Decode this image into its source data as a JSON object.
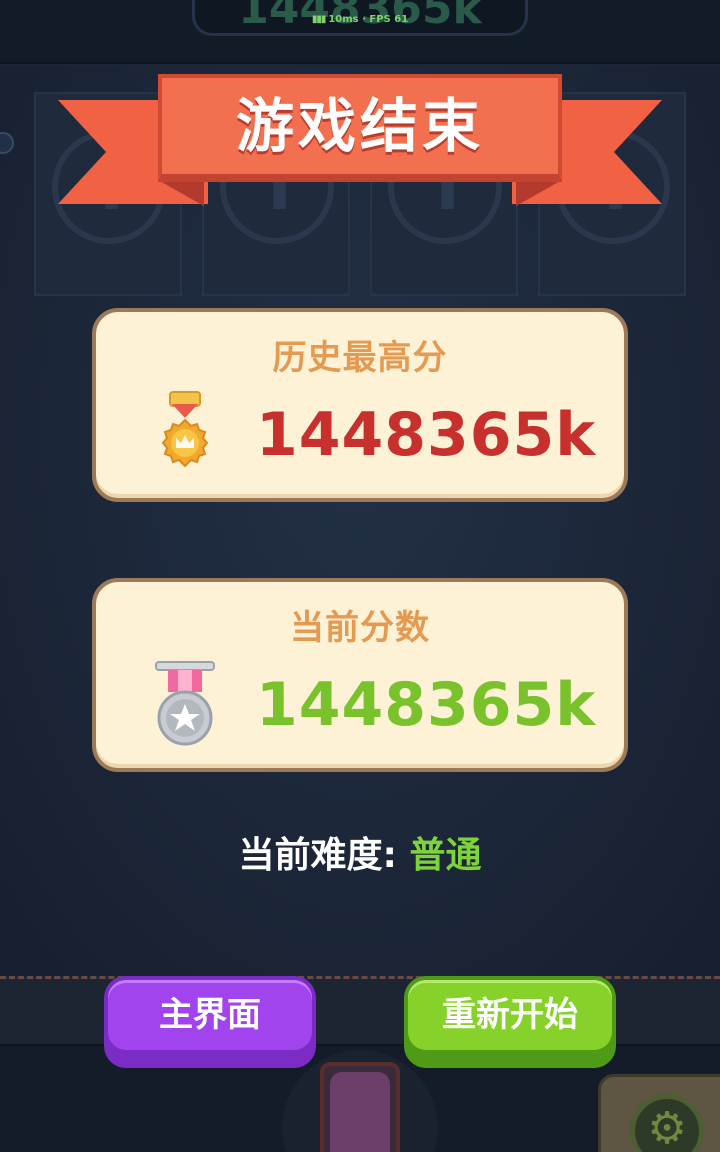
{
  "status_bar": {
    "perf": "10ms · FPS 61"
  },
  "background": {
    "top_score": "1448365k"
  },
  "dialog": {
    "title": "游戏结束",
    "best_score": {
      "label": "历史最高分",
      "value": "1448365k",
      "medal_icon": "gold-crown-medal-icon"
    },
    "current_score": {
      "label": "当前分数",
      "value": "1448365k",
      "medal_icon": "silver-star-medal-icon"
    },
    "difficulty": {
      "label": "当前难度:",
      "value": "普通"
    },
    "buttons": {
      "home": "主界面",
      "restart": "重新开始"
    }
  },
  "colors": {
    "ribbon": "#f2704f",
    "best_score": "#c7302c",
    "current_score": "#79c22c",
    "card_title": "#e59a52",
    "difficulty_value": "#7fd33a",
    "home_button": "#a144ee",
    "restart_button": "#86d22a"
  }
}
